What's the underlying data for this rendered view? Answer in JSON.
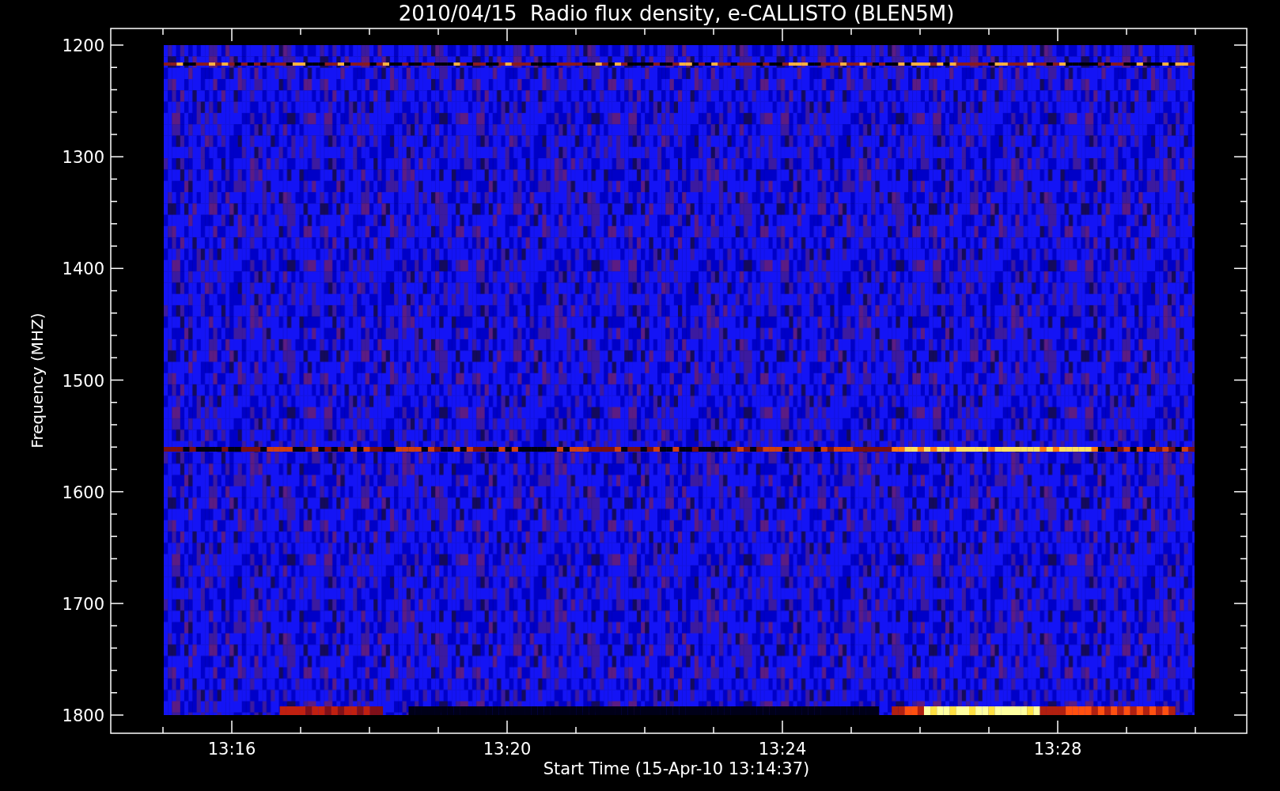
{
  "title": "2010/04/15  Radio flux density, e-CALLISTO (BLEN5M)",
  "ylabel": "Frequency (MHZ)",
  "xlabel": "Start Time (15-Apr-10 13:14:37)",
  "yticks": [
    "1200",
    "1300",
    "1400",
    "1500",
    "1600",
    "1700",
    "1800"
  ],
  "xticks": [
    "13:16",
    "13:20",
    "13:24",
    "13:28"
  ]
}
